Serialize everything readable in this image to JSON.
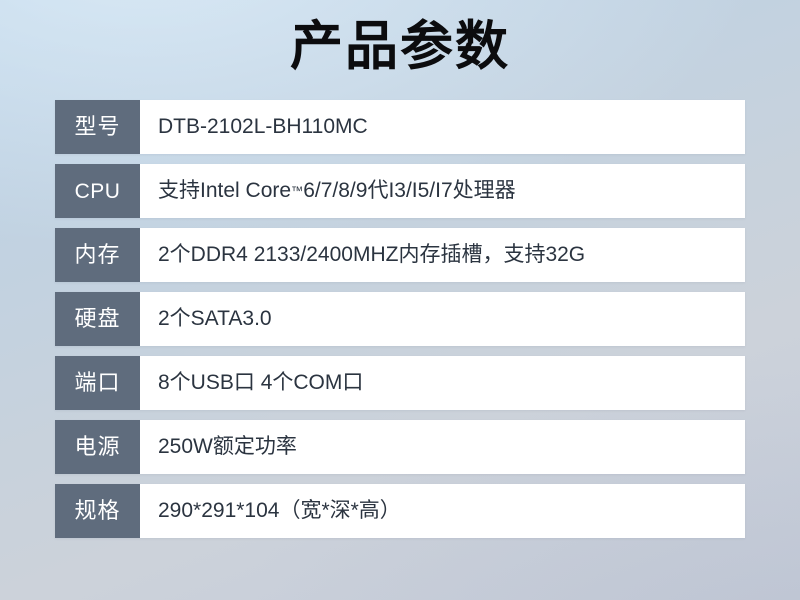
{
  "page": {
    "title": "产品参数",
    "background_top_color": "#bcd3e7",
    "background_bottom_color": "#c5cbd8",
    "label_cell_color": "#5f6c7d",
    "value_cell_color": "#ffffff",
    "value_text_color": "#2b3440",
    "title_text_color": "#0c0c0e"
  },
  "spec_table": {
    "rows": [
      {
        "label": "型号",
        "value": "DTB-2102L-BH110MC"
      },
      {
        "label": "CPU",
        "value_prefix": "支持Intel Core",
        "value_sup": "™",
        "value_suffix": "6/7/8/9代I3/I5/I7处理器",
        "value": "支持Intel Core™6/7/8/9代I3/I5/I7处理器"
      },
      {
        "label": "内存",
        "value": "2个DDR4 2133/2400MHZ内存插槽，支持32G"
      },
      {
        "label": "硬盘",
        "value": "2个SATA3.0"
      },
      {
        "label": "端口",
        "value": "8个USB口 4个COM口"
      },
      {
        "label": "电源",
        "value": "250W额定功率"
      },
      {
        "label": "规格",
        "value": "290*291*104（宽*深*高）"
      }
    ]
  }
}
